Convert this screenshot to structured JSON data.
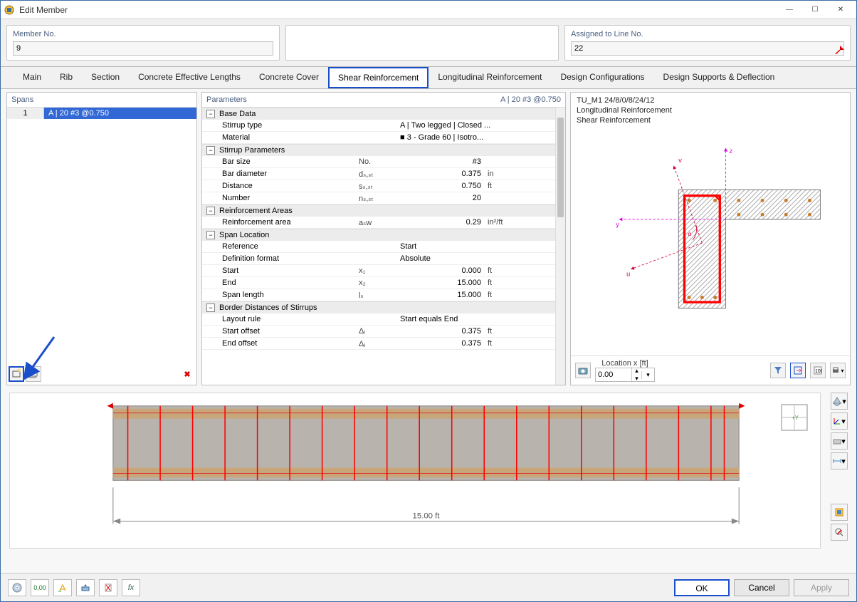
{
  "window": {
    "title": "Edit Member"
  },
  "header": {
    "member_no_label": "Member No.",
    "member_no_value": "9",
    "assigned_label": "Assigned to Line No.",
    "assigned_value": "22"
  },
  "tabs": [
    "Main",
    "Rib",
    "Section",
    "Concrete Effective Lengths",
    "Concrete Cover",
    "Shear Reinforcement",
    "Longitudinal Reinforcement",
    "Design Configurations",
    "Design Supports & Deflection"
  ],
  "active_tab_index": 5,
  "spans": {
    "title": "Spans",
    "rows": [
      {
        "index": "1",
        "text": "A | 20 #3 @0.750"
      }
    ]
  },
  "parameters": {
    "title": "Parameters",
    "title_right": "A | 20 #3 @0.750",
    "groups": [
      {
        "name": "Base Data",
        "rows": [
          {
            "k": "Stirrup type",
            "sym": "",
            "v": "A | Two legged | Closed ...",
            "u": ""
          },
          {
            "k": "Material",
            "sym": "",
            "v": "■ 3 - Grade 60 | Isotro...",
            "u": ""
          }
        ]
      },
      {
        "name": "Stirrup Parameters",
        "rows": [
          {
            "k": "Bar size",
            "sym": "No.",
            "v": "#3",
            "u": ""
          },
          {
            "k": "Bar diameter",
            "sym": "dₛ,ₛₜ",
            "v": "0.375",
            "u": "in"
          },
          {
            "k": "Distance",
            "sym": "sₛ,ₛₜ",
            "v": "0.750",
            "u": "ft"
          },
          {
            "k": "Number",
            "sym": "nₛ,ₛₜ",
            "v": "20",
            "u": ""
          }
        ]
      },
      {
        "name": "Reinforcement Areas",
        "rows": [
          {
            "k": "Reinforcement area",
            "sym": "aₛw",
            "v": "0.29",
            "u": "in²/ft"
          }
        ]
      },
      {
        "name": "Span Location",
        "rows": [
          {
            "k": "Reference",
            "sym": "",
            "v": "Start",
            "u": ""
          },
          {
            "k": "Definition format",
            "sym": "",
            "v": "Absolute",
            "u": ""
          },
          {
            "k": "Start",
            "sym": "x₁",
            "v": "0.000",
            "u": "ft"
          },
          {
            "k": "End",
            "sym": "x₂",
            "v": "15.000",
            "u": "ft"
          },
          {
            "k": "Span length",
            "sym": "lₛ",
            "v": "15.000",
            "u": "ft"
          }
        ]
      },
      {
        "name": "Border Distances of Stirrups",
        "rows": [
          {
            "k": "Layout rule",
            "sym": "",
            "v": "Start equals End",
            "u": ""
          },
          {
            "k": "Start offset",
            "sym": "Δᵢ",
            "v": "0.375",
            "u": "ft"
          },
          {
            "k": "End offset",
            "sym": "Δⱼ",
            "v": "0.375",
            "u": "ft"
          }
        ]
      }
    ]
  },
  "cross_section": {
    "title": "TU_M1 24/8/0/8/24/12",
    "line2": "Longitudinal Reinforcement",
    "line3": "Shear Reinforcement",
    "location_label": "Location x [ft]",
    "location_value": "0.00"
  },
  "beam": {
    "dimension_text": "15.00 ft"
  },
  "dialog": {
    "ok": "OK",
    "cancel": "Cancel",
    "apply": "Apply"
  },
  "icons": {
    "new_span": "new-span-icon",
    "copy_span": "copy-span-icon",
    "delete_span": "delete-icon",
    "pick_line": "pick-line-icon",
    "camera": "camera-icon",
    "filter": "filter-icon",
    "sync": "sync-icon",
    "print": "print-icon",
    "expand": "expand-icon",
    "grid": "grid-icon",
    "axes": "axes-icon",
    "fill": "fill-icon",
    "dim": "dimension-icon",
    "mag": "magnifier-icon",
    "opt": "settings-icon",
    "help": "help-icon",
    "units": "units-icon",
    "hl": "highlight-icon",
    "sym": "symmetry-icon",
    "view": "view-icon",
    "fx": "fx-icon"
  }
}
